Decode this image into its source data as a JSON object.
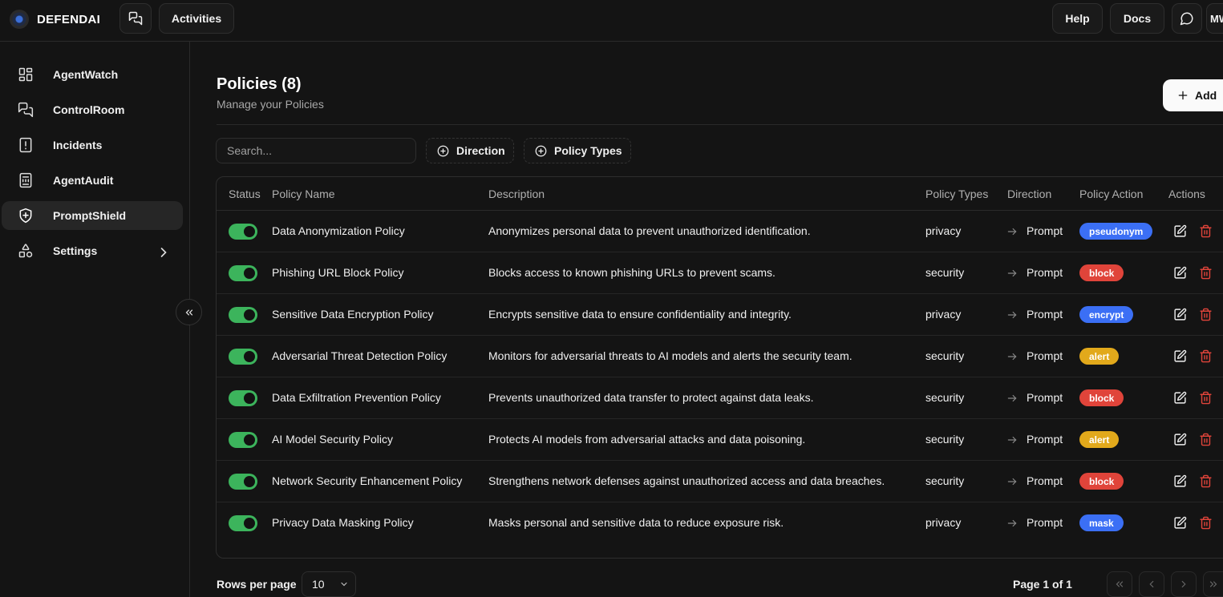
{
  "app": {
    "name": "DEFENDAI"
  },
  "topbar": {
    "activities_label": "Activities",
    "help_label": "Help",
    "docs_label": "Docs",
    "avatar_initials": "MW"
  },
  "sidebar": {
    "items": [
      {
        "label": "AgentWatch",
        "icon": "grid-icon"
      },
      {
        "label": "ControlRoom",
        "icon": "chat-icon"
      },
      {
        "label": "Incidents",
        "icon": "alert-icon"
      },
      {
        "label": "AgentAudit",
        "icon": "audit-icon"
      },
      {
        "label": "PromptShield",
        "icon": "shield-icon",
        "active": true
      },
      {
        "label": "Settings",
        "icon": "shapes-icon"
      }
    ]
  },
  "header": {
    "title": "Policies (8)",
    "subtitle": "Manage your Policies",
    "add_label": "Add"
  },
  "filters": {
    "search_placeholder": "Search...",
    "direction_label": "Direction",
    "policy_types_label": "Policy Types"
  },
  "table": {
    "columns": [
      "Status",
      "Policy Name",
      "Description",
      "Policy Types",
      "Direction",
      "Policy Action",
      "Actions"
    ],
    "rows": [
      {
        "name": "Data Anonymization Policy",
        "description": "Anonymizes personal data to prevent unauthorized identification.",
        "type": "privacy",
        "direction": "Prompt",
        "action": "pseudonym",
        "action_color": "#3b6ff5",
        "enabled": true
      },
      {
        "name": "Phishing URL Block Policy",
        "description": "Blocks access to known phishing URLs to prevent scams.",
        "type": "security",
        "direction": "Prompt",
        "action": "block",
        "action_color": "#e0443a",
        "enabled": true
      },
      {
        "name": "Sensitive Data Encryption Policy",
        "description": "Encrypts sensitive data to ensure confidentiality and integrity.",
        "type": "privacy",
        "direction": "Prompt",
        "action": "encrypt",
        "action_color": "#3b6ff5",
        "enabled": true
      },
      {
        "name": "Adversarial Threat Detection Policy",
        "description": "Monitors for adversarial threats to AI models and alerts the security team.",
        "type": "security",
        "direction": "Prompt",
        "action": "alert",
        "action_color": "#e2a91b",
        "enabled": true
      },
      {
        "name": "Data Exfiltration Prevention Policy",
        "description": "Prevents unauthorized data transfer to protect against data leaks.",
        "type": "security",
        "direction": "Prompt",
        "action": "block",
        "action_color": "#e0443a",
        "enabled": true
      },
      {
        "name": "AI Model Security Policy",
        "description": "Protects AI models from adversarial attacks and data poisoning.",
        "type": "security",
        "direction": "Prompt",
        "action": "alert",
        "action_color": "#e2a91b",
        "enabled": true
      },
      {
        "name": "Network Security Enhancement Policy",
        "description": "Strengthens network defenses against unauthorized access and data breaches.",
        "type": "security",
        "direction": "Prompt",
        "action": "block",
        "action_color": "#e0443a",
        "enabled": true
      },
      {
        "name": "Privacy Data Masking Policy",
        "description": "Masks personal and sensitive data to reduce exposure risk.",
        "type": "privacy",
        "direction": "Prompt",
        "action": "mask",
        "action_color": "#3b6ff5",
        "enabled": true
      }
    ]
  },
  "footer": {
    "rows_per_page_label": "Rows per page",
    "rows_per_page_value": "10",
    "page_label": "Page 1 of 1"
  },
  "colors": {
    "background": "#141414",
    "toggle_on": "#3cb45c",
    "delete_icon": "#e0443a"
  }
}
